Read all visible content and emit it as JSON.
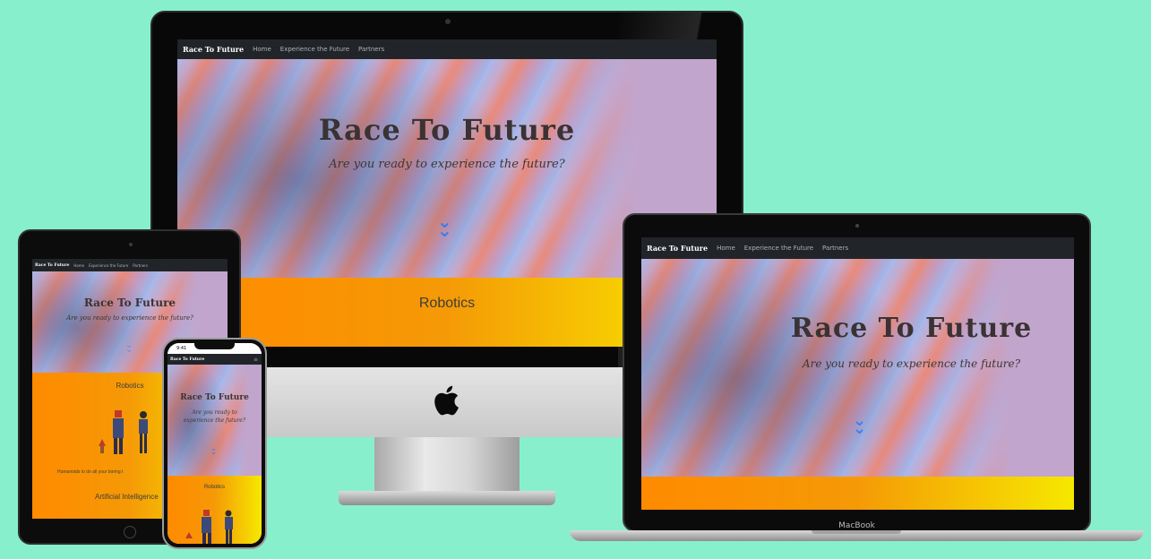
{
  "site": {
    "brand": "Race To Future",
    "nav": [
      "Home",
      "Experience the Future",
      "Partners"
    ],
    "hero_title": "Race To Future",
    "hero_subtitle": "Are you ready to experience the future?",
    "section_robotics": "Robotics",
    "section_ai": "Artificial Intelligence",
    "robotics_caption": "Humanoids to do all your boring t"
  },
  "phone": {
    "status_time": "9:41",
    "hero_subtitle_line1": "Are you ready to",
    "hero_subtitle_line2": "experience the future?"
  },
  "laptop": {
    "label": "MacBook"
  },
  "icons": {
    "scroll_down": "chevron-double-down-icon",
    "apple": "apple-logo-icon",
    "hamburger": "menu-icon"
  },
  "colors": {
    "background": "#87efcc",
    "navbar": "#212529",
    "gradient_start": "#ff8a00",
    "gradient_end": "#f6e800",
    "chevron": "#3c7cf0"
  }
}
